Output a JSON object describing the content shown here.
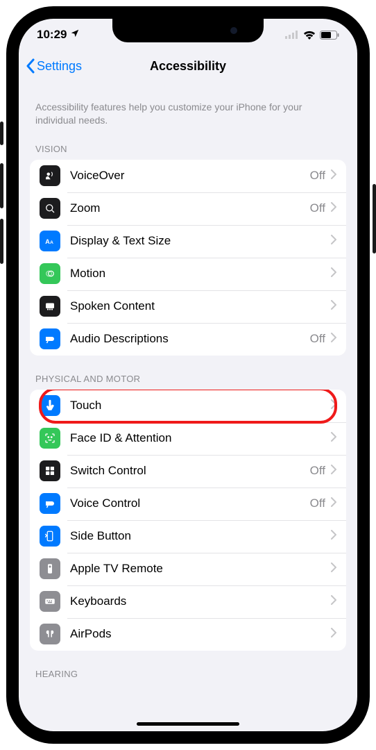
{
  "status": {
    "time": "10:29"
  },
  "nav": {
    "back": "Settings",
    "title": "Accessibility"
  },
  "intro": "Accessibility features help you customize your iPhone for your individual needs.",
  "sections": {
    "vision": {
      "header": "VISION",
      "items": [
        {
          "label": "VoiceOver",
          "value": "Off"
        },
        {
          "label": "Zoom",
          "value": "Off"
        },
        {
          "label": "Display & Text Size",
          "value": ""
        },
        {
          "label": "Motion",
          "value": ""
        },
        {
          "label": "Spoken Content",
          "value": ""
        },
        {
          "label": "Audio Descriptions",
          "value": "Off"
        }
      ]
    },
    "physical": {
      "header": "PHYSICAL AND MOTOR",
      "items": [
        {
          "label": "Touch",
          "value": ""
        },
        {
          "label": "Face ID & Attention",
          "value": ""
        },
        {
          "label": "Switch Control",
          "value": "Off"
        },
        {
          "label": "Voice Control",
          "value": "Off"
        },
        {
          "label": "Side Button",
          "value": ""
        },
        {
          "label": "Apple TV Remote",
          "value": ""
        },
        {
          "label": "Keyboards",
          "value": ""
        },
        {
          "label": "AirPods",
          "value": ""
        }
      ]
    },
    "hearing": {
      "header": "HEARING"
    }
  },
  "highlighted_row": "Touch"
}
